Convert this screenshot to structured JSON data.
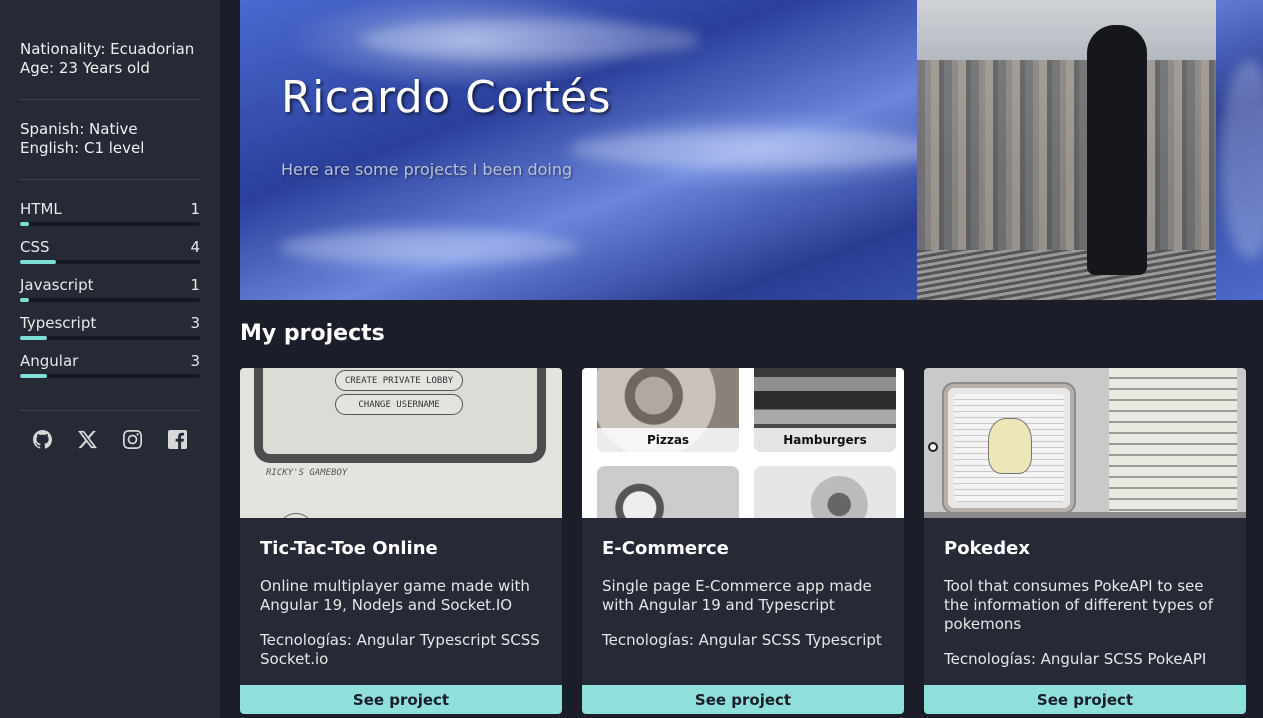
{
  "sidebar": {
    "personal": {
      "nationality": "Nationality: Ecuadorian",
      "age": "Age: 23 Years old"
    },
    "languages": {
      "spanish": "Spanish: Native",
      "english": "English: C1 level"
    },
    "skills": [
      {
        "name": "HTML",
        "level": "1",
        "fraction": 0.05
      },
      {
        "name": "CSS",
        "level": "4",
        "fraction": 0.2
      },
      {
        "name": "Javascript",
        "level": "1",
        "fraction": 0.05
      },
      {
        "name": "Typescript",
        "level": "3",
        "fraction": 0.15
      },
      {
        "name": "Angular",
        "level": "3",
        "fraction": 0.15
      }
    ],
    "socials": [
      "github-icon",
      "x-icon",
      "instagram-icon",
      "facebook-icon"
    ]
  },
  "hero": {
    "name": "Ricardo Cortés",
    "subtitle": "Here are some projects I been doing"
  },
  "projects": {
    "title": "My projects",
    "items": [
      {
        "title": "Tic-Tac-Toe Online",
        "description": "Online multiplayer game made with Angular 19, NodeJs and Socket.IO",
        "tech": "Tecnologías: Angular Typescript SCSS Socket.io",
        "button": "See project",
        "thumb": {
          "btn1": "CREATE PRIVATE LOBBY",
          "btn2": "CHANGE USERNAME",
          "label": "RICKY'S GAMEBOY"
        }
      },
      {
        "title": "E-Commerce",
        "description": "Single page E-Commerce app made with Angular 19 and Typescript",
        "tech": "Tecnologías: Angular SCSS Typescript",
        "button": "See project",
        "thumb": {
          "tile1": "Pizzas",
          "tile2": "Hamburgers"
        }
      },
      {
        "title": "Pokedex",
        "description": "Tool that consumes PokeAPI to see the information of different types of pokemons",
        "tech": "Tecnologías: Angular SCSS PokeAPI",
        "button": "See project"
      }
    ]
  },
  "colors": {
    "background": "#1b1e29",
    "sidebar": "#252a36",
    "accent": "#8fe0da"
  }
}
